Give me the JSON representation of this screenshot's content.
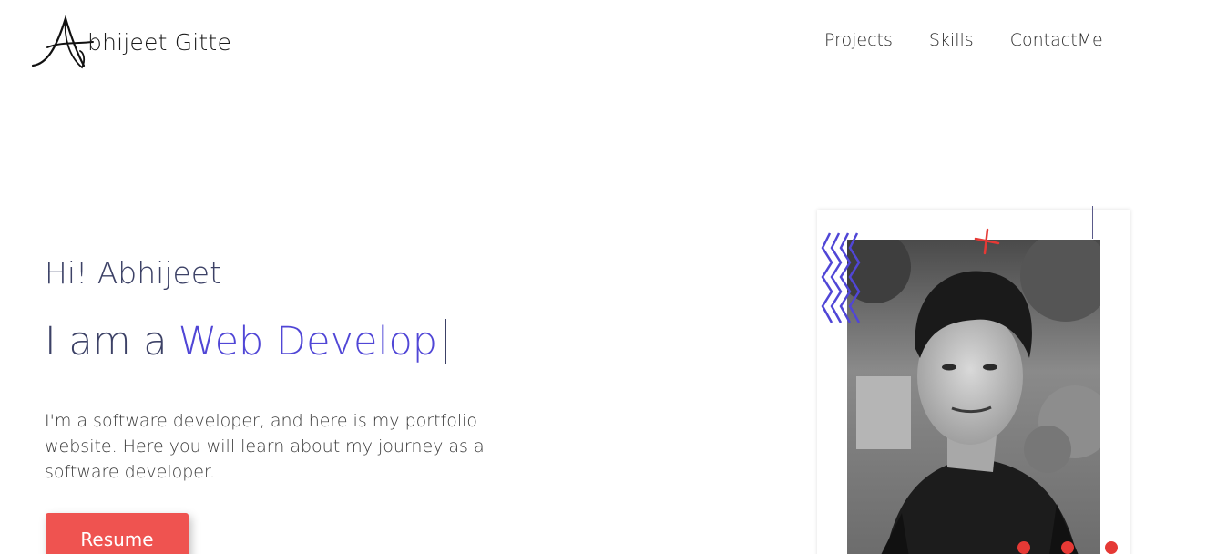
{
  "header": {
    "logo_text": "bhijeet Gitte",
    "nav": [
      "Projects",
      "Skills",
      "ContactMe"
    ]
  },
  "hero": {
    "greeting": "Hi! Abhijeet",
    "role_prefix": "I am a",
    "role_typed": "Web Develop",
    "intro": "I'm a software developer, and here is my portfolio website. Here you will learn about my journey as a software developer.",
    "resume_label": "Resume"
  },
  "colors": {
    "accent": "#5046d6",
    "button": "#ef5350",
    "text": "#3c4166",
    "decor_red": "#e53935"
  }
}
